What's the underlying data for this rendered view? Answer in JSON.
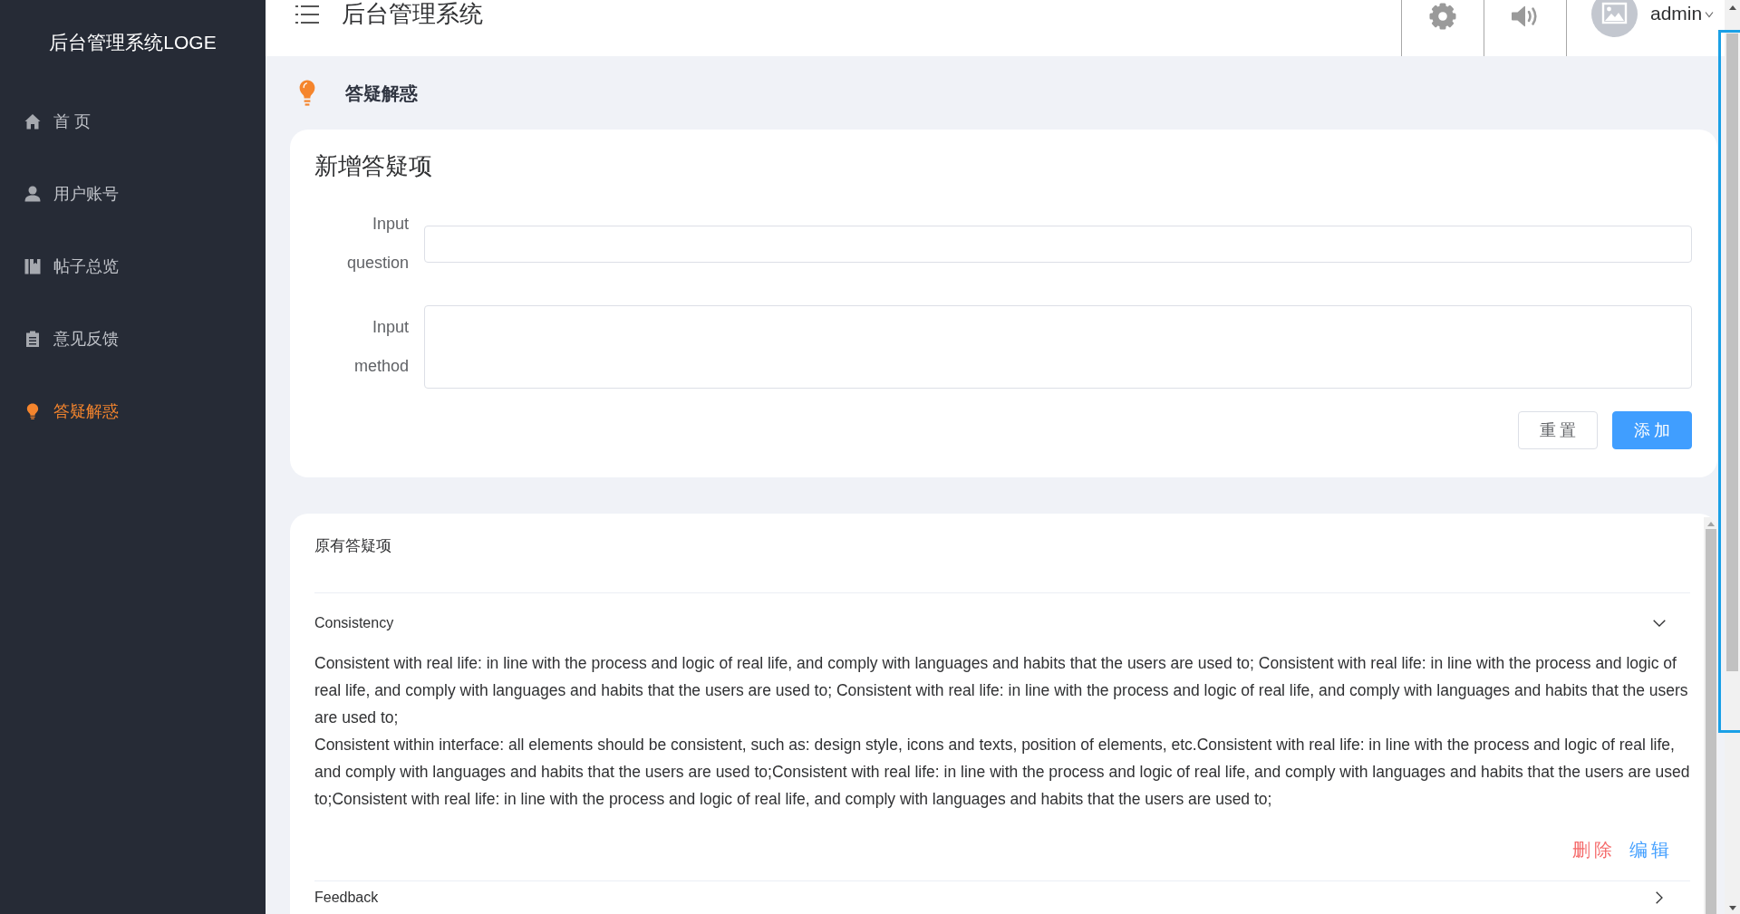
{
  "sidebar": {
    "title": "后台管理系统LOGE",
    "items": [
      {
        "label": "首 页",
        "selected": false
      },
      {
        "label": "用户账号",
        "selected": false
      },
      {
        "label": "帖子总览",
        "selected": false
      },
      {
        "label": "意见反馈",
        "selected": false
      },
      {
        "label": "答疑解惑",
        "selected": true
      }
    ]
  },
  "header": {
    "title": "后台管理系统",
    "user": "admin"
  },
  "page": {
    "title": "答疑解惑"
  },
  "add_form": {
    "title": "新增答疑项",
    "fields": [
      {
        "label": "Input question",
        "kind": "input"
      },
      {
        "label": "Input method",
        "kind": "textarea"
      }
    ],
    "buttons": [
      {
        "label": "重置",
        "kind": "default"
      },
      {
        "label": "添加",
        "kind": "primary"
      }
    ]
  },
  "existing": {
    "title": "原有答疑项",
    "items": [
      {
        "title": "Consistency",
        "expanded": true,
        "paragraphs": [
          "Consistent with real life: in line with the process and logic of real life, and comply with languages and habits that the users are used to; Consistent with real life: in line with the process and logic of real life, and comply with languages and habits that the users are used to; Consistent with real life: in line with the process and logic of real life, and comply with languages and habits that the users are used to;",
          "Consistent within interface: all elements should be consistent, such as: design style, icons and texts, position of elements, etc.Consistent with real life: in line with the process and logic of real life, and comply with languages and habits that the users are used to;Consistent with real life: in line with the process and logic of real life, and comply with languages and habits that the users are used to;Consistent with real life: in line with the process and logic of real life, and comply with languages and habits that the users are used to;"
        ],
        "actions": [
          {
            "label": "删除",
            "kind": "danger"
          },
          {
            "label": "编辑",
            "kind": "primary"
          }
        ]
      },
      {
        "title": "Feedback",
        "expanded": false
      }
    ]
  }
}
